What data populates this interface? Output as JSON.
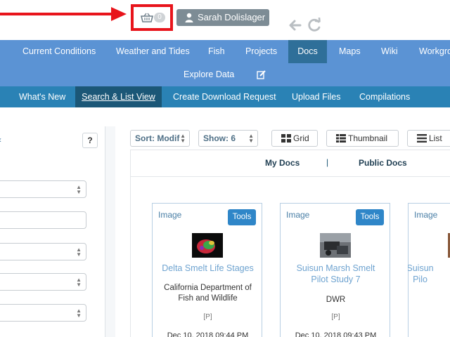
{
  "header": {
    "basket_count": "0",
    "user_name": "Sarah Dolislager"
  },
  "main_nav": {
    "items": [
      {
        "label": "Current Conditions"
      },
      {
        "label": "Weather and Tides"
      },
      {
        "label": "Fish"
      },
      {
        "label": "Projects"
      },
      {
        "label": "Docs",
        "active": true
      },
      {
        "label": "Maps"
      },
      {
        "label": "Wiki"
      },
      {
        "label": "Workgro"
      }
    ],
    "explore_label": "Explore Data"
  },
  "sub_nav": {
    "items": [
      {
        "label": "What's New"
      },
      {
        "label": "Search & List View",
        "active": true
      },
      {
        "label": "Create Download Request"
      },
      {
        "label": "Upload Files"
      },
      {
        "label": "Compilations"
      }
    ]
  },
  "left_panel": {
    "help_label": "?"
  },
  "toolbar": {
    "sort_value": "Sort: Modif",
    "show_value": "Show: 6",
    "grid_label": "Grid",
    "thumbnail_label": "Thumbnail",
    "list_label": "List"
  },
  "docs_tabs": {
    "my_docs": "My Docs",
    "separator": "|",
    "public_docs": "Public Docs"
  },
  "cards": [
    {
      "type": "Image",
      "tools_label": "Tools",
      "title_line1": "Delta Smelt Life Stages",
      "title_line2": "",
      "org_line1": "California Department of",
      "org_line2": "Fish and Wildlife",
      "visibility": "[P]",
      "date": "Dec 10, 2018 09:44 PM"
    },
    {
      "type": "Image",
      "tools_label": "Tools",
      "title_line1": "Suisun Marsh Smelt",
      "title_line2": "Pilot Study 7",
      "org_line1": "DWR",
      "org_line2": "",
      "visibility": "[P]",
      "date": "Dec 10, 2018 09:43 PM"
    },
    {
      "type": "Image",
      "title_line1": "Suisun",
      "title_line2": "Pilo"
    }
  ],
  "colors": {
    "main_nav_bg": "#5b93d4",
    "main_nav_active": "#2f6f99",
    "sub_nav_bg": "#2a82b5",
    "sub_nav_active": "#1b5777",
    "highlight_red": "#e8141b",
    "tools_button": "#2f86c8",
    "user_button": "#7d8c95"
  },
  "icons": {
    "basket": "basket-icon",
    "user": "user-icon",
    "back": "back-arrow-icon",
    "refresh": "refresh-icon",
    "edit": "edit-icon",
    "grid": "grid-icon",
    "thumbnail": "thumbnail-icon",
    "list": "list-icon"
  }
}
